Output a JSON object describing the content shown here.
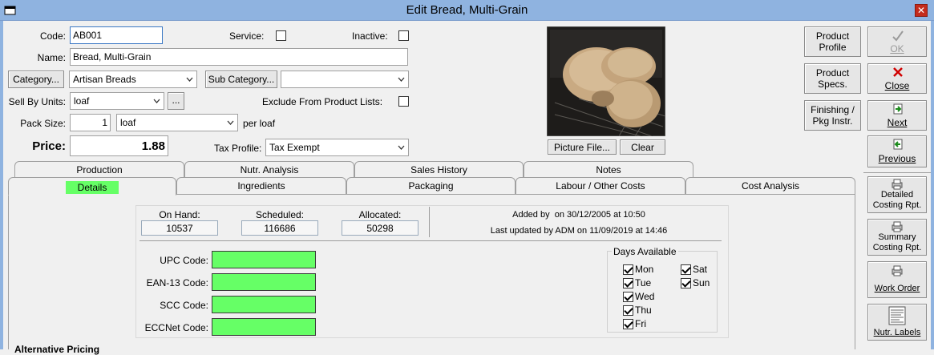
{
  "window": {
    "title": "Edit Bread, Multi-Grain"
  },
  "form": {
    "code_label": "Code:",
    "code_value": "AB001",
    "service_label": "Service:",
    "service_checked": false,
    "inactive_label": "Inactive:",
    "inactive_checked": false,
    "name_label": "Name:",
    "name_value": "Bread, Multi-Grain",
    "category_button": "Category...",
    "category_value": "Artisan Breads",
    "subcategory_button": "Sub Category...",
    "subcategory_value": "",
    "sell_by_label": "Sell By Units:",
    "sell_by_value": "loaf",
    "ellipsis_button": "...",
    "exclude_label": "Exclude From Product Lists:",
    "exclude_checked": false,
    "pack_size_label": "Pack Size:",
    "pack_size_value": "1",
    "pack_unit_value": "loaf",
    "per_unit_text": "per loaf",
    "price_label": "Price:",
    "price_value": "1.88",
    "tax_label": "Tax Profile:",
    "tax_value": "Tax Exempt"
  },
  "picture": {
    "file_button": "Picture File...",
    "clear_button": "Clear"
  },
  "action_buttons": {
    "product_profile": "Product Profile",
    "ok": "OK",
    "product_specs": "Product Specs.",
    "close": "Close",
    "finishing": "Finishing / Pkg Instr.",
    "next": "Next",
    "previous": "Previous"
  },
  "tabs_back": [
    "Production",
    "Nutr. Analysis",
    "Sales History",
    "Notes"
  ],
  "tabs_front": [
    "Details",
    "Ingredients",
    "Packaging",
    "Labour / Other Costs",
    "Cost Analysis"
  ],
  "details": {
    "on_hand_label": "On Hand:",
    "on_hand_value": "10537",
    "scheduled_label": "Scheduled:",
    "scheduled_value": "116686",
    "allocated_label": "Allocated:",
    "allocated_value": "50298",
    "added_text": "Added by  on 30/12/2005 at 10:50",
    "updated_text": "Last updated by ADM on 11/09/2019 at 14:46",
    "upc_label": "UPC Code:",
    "upc_value": "",
    "ean_label": "EAN-13 Code:",
    "ean_value": "",
    "scc_label": "SCC Code:",
    "scc_value": "",
    "eccnet_label": "ECCNet Code:",
    "eccnet_value": "",
    "days_title": "Days Available",
    "days": [
      {
        "label": "Mon",
        "checked": true
      },
      {
        "label": "Tue",
        "checked": true
      },
      {
        "label": "Wed",
        "checked": true
      },
      {
        "label": "Thu",
        "checked": true
      },
      {
        "label": "Fri",
        "checked": true
      },
      {
        "label": "Sat",
        "checked": true
      },
      {
        "label": "Sun",
        "checked": true
      }
    ],
    "cut_off_text": "Alternative Pricing"
  },
  "side_buttons": {
    "detailed": "Detailed Costing Rpt.",
    "summary": "Summary Costing Rpt.",
    "work_order": "Work Order",
    "nutr_labels": "Nutr. Labels"
  },
  "colors": {
    "titlebar": "#8fb3e0",
    "green_field": "#66ff66",
    "close_red": "#c42b1c"
  }
}
